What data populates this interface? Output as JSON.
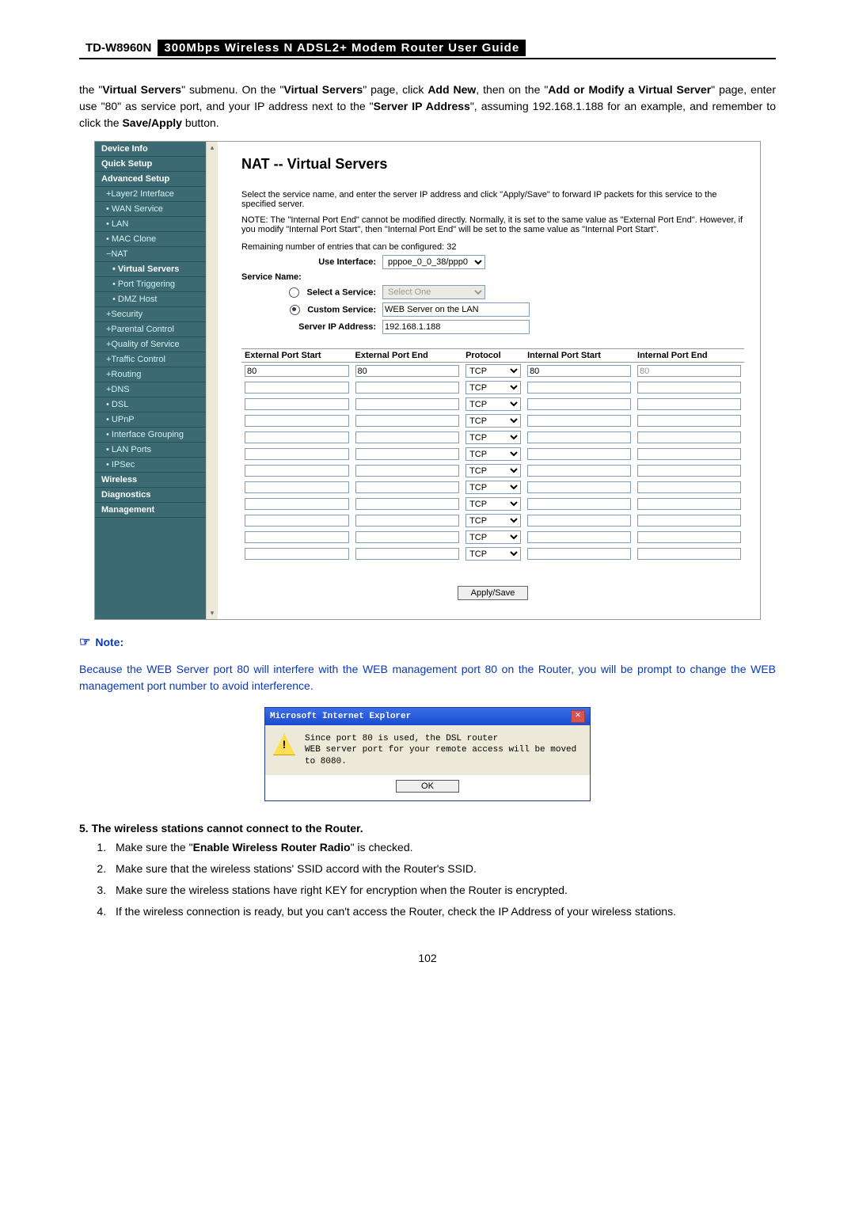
{
  "header": {
    "model": "TD-W8960N",
    "title": "300Mbps Wireless N ADSL2+ Modem Router User Guide"
  },
  "intro": {
    "l1a": "the \"",
    "l1b": "Virtual Servers",
    "l1c": "\" submenu. On the \"",
    "l1d": "Virtual Servers",
    "l1e": "\" page, click ",
    "l1f": "Add New",
    "l1g": ", then on the \"",
    "l1h": "Add or Modify a Virtual Server",
    "l1i": "\" page, enter use \"80\" as service port, and your IP address next to the \"",
    "l1j": "Server IP Address",
    "l1k": "\", assuming 192.168.1.188 for an example, and remember to click the ",
    "l1l": "Save/Apply",
    "l1m": " button."
  },
  "sidebar": [
    {
      "label": "Device Info",
      "cls": "item bold"
    },
    {
      "label": "Quick Setup",
      "cls": "item bold"
    },
    {
      "label": "Advanced Setup",
      "cls": "item bold"
    },
    {
      "label": "+Layer2 Interface",
      "cls": "item sub1"
    },
    {
      "label": "• WAN Service",
      "cls": "item sub1"
    },
    {
      "label": "• LAN",
      "cls": "item sub1"
    },
    {
      "label": "• MAC Clone",
      "cls": "item sub1"
    },
    {
      "label": "−NAT",
      "cls": "item sub1"
    },
    {
      "label": "• Virtual Servers",
      "cls": "item sub2 active"
    },
    {
      "label": "• Port Triggering",
      "cls": "item sub2"
    },
    {
      "label": "• DMZ Host",
      "cls": "item sub2"
    },
    {
      "label": "+Security",
      "cls": "item sub1"
    },
    {
      "label": "+Parental Control",
      "cls": "item sub1"
    },
    {
      "label": "+Quality of Service",
      "cls": "item sub1"
    },
    {
      "label": "+Traffic Control",
      "cls": "item sub1"
    },
    {
      "label": "+Routing",
      "cls": "item sub1"
    },
    {
      "label": "+DNS",
      "cls": "item sub1"
    },
    {
      "label": "• DSL",
      "cls": "item sub1"
    },
    {
      "label": "• UPnP",
      "cls": "item sub1"
    },
    {
      "label": "• Interface Grouping",
      "cls": "item sub1"
    },
    {
      "label": "• LAN Ports",
      "cls": "item sub1"
    },
    {
      "label": "• IPSec",
      "cls": "item sub1"
    },
    {
      "label": "Wireless",
      "cls": "item bold"
    },
    {
      "label": "Diagnostics",
      "cls": "item bold"
    },
    {
      "label": "Management",
      "cls": "item bold"
    }
  ],
  "vs": {
    "title": "NAT -- Virtual Servers",
    "desc": "Select the service name, and enter the server IP address and click \"Apply/Save\" to forward IP packets for this service to the specified server.",
    "note": "NOTE: The \"Internal Port End\" cannot be modified directly. Normally, it is set to the same value as \"External Port End\". However, if you modify \"Internal Port Start\", then \"Internal Port End\" will be set to the same value as \"Internal Port Start\".",
    "remain": "Remaining number of entries that can be configured: 32",
    "labels": {
      "use_if": "Use Interface:",
      "svc_name": "Service Name:",
      "select_svc": "Select a Service:",
      "custom_svc": "Custom Service:",
      "server_ip": "Server IP Address:"
    },
    "values": {
      "use_if": "pppoe_0_0_38/ppp0",
      "select_svc": "Select One",
      "custom_svc": "WEB Server on the LAN",
      "server_ip": "192.168.1.188"
    },
    "cols": [
      "External Port Start",
      "External Port End",
      "Protocol",
      "Internal Port Start",
      "Internal Port End"
    ],
    "rows": [
      {
        "eps": "80",
        "epe": "80",
        "proto": "TCP",
        "ips": "80",
        "ipe": "80"
      },
      {
        "eps": "",
        "epe": "",
        "proto": "TCP",
        "ips": "",
        "ipe": ""
      },
      {
        "eps": "",
        "epe": "",
        "proto": "TCP",
        "ips": "",
        "ipe": ""
      },
      {
        "eps": "",
        "epe": "",
        "proto": "TCP",
        "ips": "",
        "ipe": ""
      },
      {
        "eps": "",
        "epe": "",
        "proto": "TCP",
        "ips": "",
        "ipe": ""
      },
      {
        "eps": "",
        "epe": "",
        "proto": "TCP",
        "ips": "",
        "ipe": ""
      },
      {
        "eps": "",
        "epe": "",
        "proto": "TCP",
        "ips": "",
        "ipe": ""
      },
      {
        "eps": "",
        "epe": "",
        "proto": "TCP",
        "ips": "",
        "ipe": ""
      },
      {
        "eps": "",
        "epe": "",
        "proto": "TCP",
        "ips": "",
        "ipe": ""
      },
      {
        "eps": "",
        "epe": "",
        "proto": "TCP",
        "ips": "",
        "ipe": ""
      },
      {
        "eps": "",
        "epe": "",
        "proto": "TCP",
        "ips": "",
        "ipe": ""
      },
      {
        "eps": "",
        "epe": "",
        "proto": "TCP",
        "ips": "",
        "ipe": ""
      }
    ],
    "apply": "Apply/Save"
  },
  "pnote": {
    "label": "Note:",
    "body": "Because the WEB Server port 80 will interfere with the WEB management port 80 on the Router, you will be prompt to change the WEB management port number to avoid interference."
  },
  "ie": {
    "title": "Microsoft Internet Explorer",
    "msg": "Since port 80 is used, the DSL router\nWEB server port for your remote access will be moved to 8080.",
    "ok": "OK"
  },
  "sec5": {
    "h": "5.    The wireless stations cannot connect to the Router.",
    "i1a": "Make sure the \"",
    "i1b": "Enable Wireless Router Radio",
    "i1c": "\" is checked.",
    "i2": "Make sure that the wireless stations' SSID accord with the Router's SSID.",
    "i3": "Make sure the wireless stations have right KEY for encryption when the Router is encrypted.",
    "i4": "If the wireless connection is ready, but you can't access the Router, check the IP Address of your wireless stations."
  },
  "pagenum": "102"
}
